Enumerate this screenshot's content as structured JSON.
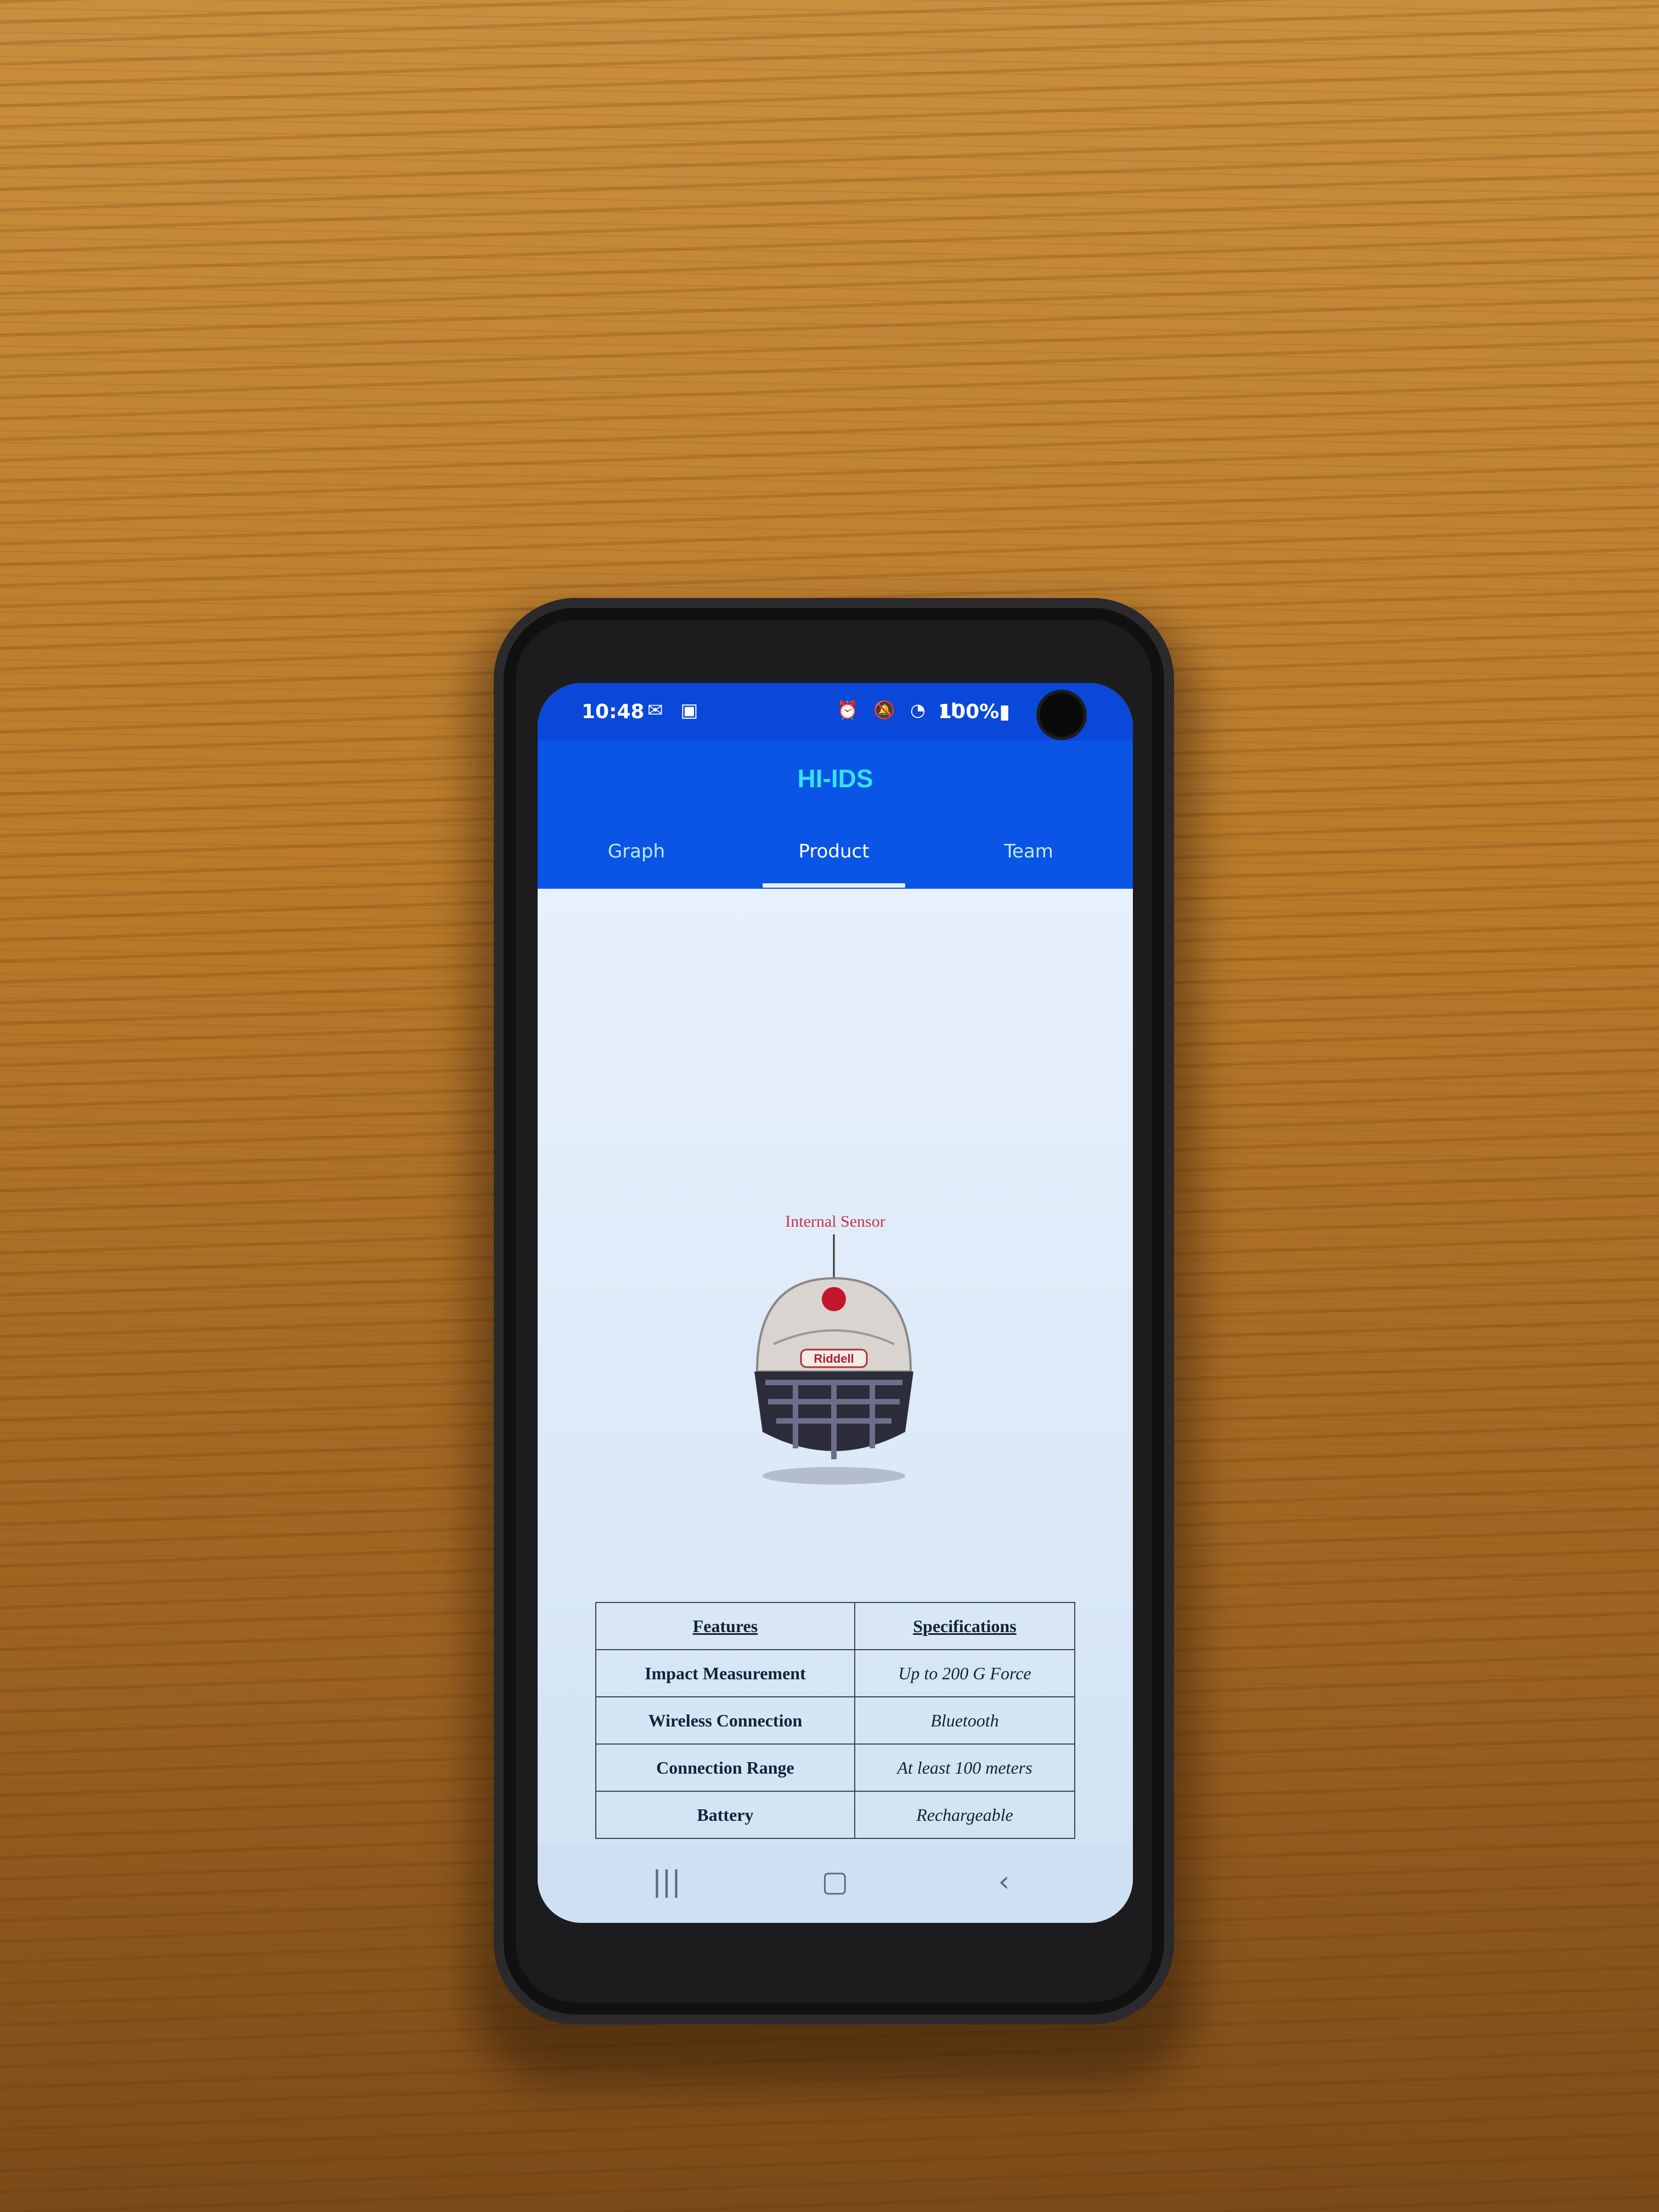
{
  "status_bar": {
    "time": "10:48",
    "left_icons": "✉ ▣",
    "right_icons": "⏰ 🔕 ◔ ıl",
    "battery": "100%▮"
  },
  "app": {
    "title": "HI-IDS",
    "tabs": [
      {
        "label": "Graph",
        "active": false
      },
      {
        "label": "Product",
        "active": true
      },
      {
        "label": "Team",
        "active": false
      }
    ]
  },
  "product": {
    "sensor_label": "Internal Sensor",
    "helmet_brand": "Riddell",
    "table": {
      "headers": [
        "Features",
        "Specifications"
      ],
      "rows": [
        [
          "Impact Measurement",
          "Up to 200 G Force"
        ],
        [
          "Wireless Connection",
          "Bluetooth"
        ],
        [
          "Connection Range",
          "At least 100 meters"
        ],
        [
          "Battery",
          "Rechargeable"
        ]
      ]
    }
  },
  "nav": {
    "recents": "|||",
    "home": "▢",
    "back": "‹"
  },
  "colors": {
    "header_blue": "#0a55e6",
    "title_cyan": "#37e0f0",
    "sensor_red": "#c2354f"
  }
}
